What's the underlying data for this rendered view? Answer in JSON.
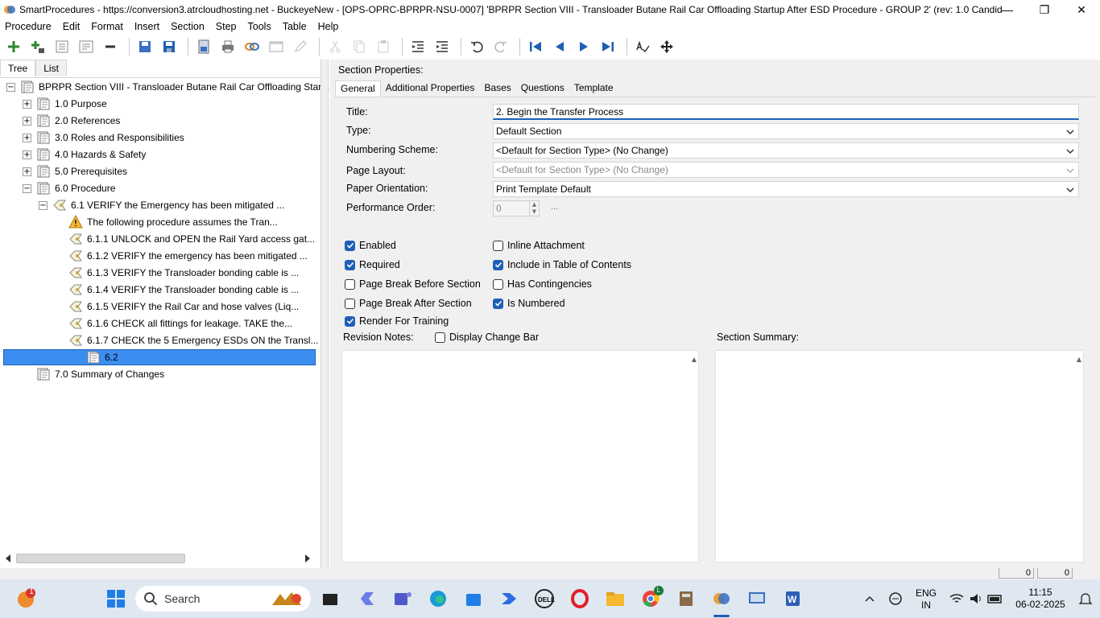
{
  "window": {
    "title": "SmartProcedures - https://conversion3.atrcloudhosting.net - BuckeyeNew - [OPS-OPRC-BPRPR-NSU-0007] 'BPRPR Section VIII - Transloader Butane Rail Car Offloading Startup After ESD Procedure - GROUP 2' (rev: 1.0 Candidat...",
    "controls": {
      "minimize": "—",
      "maximize": "❐",
      "close": "✕"
    }
  },
  "menu": [
    "Procedure",
    "Edit",
    "Format",
    "Insert",
    "Section",
    "Step",
    "Tools",
    "Table",
    "Help"
  ],
  "left_tabs": {
    "tree": "Tree",
    "list": "List"
  },
  "tree": [
    {
      "label": "BPRPR Section VIII - Transloader Butane Rail Car Offloading Start...",
      "level": 0,
      "expander": "−",
      "icon": "procedure-icon"
    },
    {
      "label": "1.0 Purpose",
      "level": 1,
      "expander": "+",
      "icon": "section-icon"
    },
    {
      "label": "2.0 References",
      "level": 1,
      "expander": "+",
      "icon": "section-icon"
    },
    {
      "label": "3.0 Roles and Responsibilities",
      "level": 1,
      "expander": "+",
      "icon": "section-icon"
    },
    {
      "label": "4.0 Hazards & Safety",
      "level": 1,
      "expander": "+",
      "icon": "section-icon"
    },
    {
      "label": "5.0 Prerequisites",
      "level": 1,
      "expander": "+",
      "icon": "section-icon"
    },
    {
      "label": "6.0 Procedure",
      "level": 1,
      "expander": "−",
      "icon": "section-icon"
    },
    {
      "label": "6.1 VERIFY the Emergency has been mitigated ...",
      "level": 2,
      "expander": "−",
      "icon": "step-icon"
    },
    {
      "label": "The following procedure assumes the Tran...",
      "level": 3,
      "expander": "",
      "icon": "warning-icon"
    },
    {
      "label": "6.1.1 UNLOCK and OPEN the Rail Yard access gat...",
      "level": 3,
      "expander": "",
      "icon": "step-icon"
    },
    {
      "label": "6.1.2 VERIFY the emergency has been mitigated ...",
      "level": 3,
      "expander": "",
      "icon": "step-icon"
    },
    {
      "label": "6.1.3 VERIFY the Transloader bonding cable is ...",
      "level": 3,
      "expander": "",
      "icon": "step-icon"
    },
    {
      "label": "6.1.4 VERIFY the Transloader bonding cable is ...",
      "level": 3,
      "expander": "",
      "icon": "step-icon"
    },
    {
      "label": "6.1.5 VERIFY the Rail Car and hose valves (Liq...",
      "level": 3,
      "expander": "",
      "icon": "step-icon"
    },
    {
      "label": "6.1.6 CHECK all fittings for leakage. TAKE the...",
      "level": 3,
      "expander": "",
      "icon": "step-icon"
    },
    {
      "label": "6.1.7 CHECK the 5 Emergency ESDs ON the Transl...",
      "level": 3,
      "expander": "",
      "icon": "step-icon"
    },
    {
      "label": "6.2",
      "level": 2,
      "expander": "",
      "icon": "section-icon",
      "selected": true
    },
    {
      "label": "7.0 Summary of Changes",
      "level": 1,
      "expander": "",
      "icon": "section-icon"
    }
  ],
  "section_properties": {
    "heading": "Section Properties:",
    "tabs": [
      "General",
      "Additional Properties",
      "Bases",
      "Questions",
      "Template"
    ],
    "fields": {
      "title_label": "Title:",
      "title_value": "2.        Begin the Transfer Process",
      "type_label": "Type:",
      "type_value": "Default Section",
      "numbering_label": "Numbering Scheme:",
      "numbering_value": "<Default for Section Type> (No Change)",
      "layout_label": "Page Layout:",
      "layout_value": "<Default for Section Type> (No Change)",
      "orientation_label": "Paper Orientation:",
      "orientation_value": "Print Template Default",
      "perf_label": "Performance Order:",
      "perf_value": "0",
      "perf_button": "..."
    },
    "checkboxes": {
      "enabled": {
        "label": "Enabled",
        "checked": true
      },
      "required": {
        "label": "Required",
        "checked": true
      },
      "page_break_before": {
        "label": "Page Break Before Section",
        "checked": false
      },
      "page_break_after": {
        "label": "Page Break After Section",
        "checked": false
      },
      "render_training": {
        "label": "Render For Training",
        "checked": true
      },
      "inline_attachment": {
        "label": "Inline Attachment",
        "checked": false
      },
      "include_toc": {
        "label": "Include in Table of Contents",
        "checked": true
      },
      "has_contingencies": {
        "label": "Has Contingencies",
        "checked": false
      },
      "is_numbered": {
        "label": "Is Numbered",
        "checked": true
      },
      "display_change_bar": {
        "label": "Display Change Bar",
        "checked": false
      }
    },
    "revision_notes_label": "Revision Notes:",
    "section_summary_label": "Section Summary:"
  },
  "status": {
    "field1": "0",
    "field2": "0"
  },
  "taskbar": {
    "search_label": "Search",
    "notification_count": "1",
    "lang": "ENG",
    "region": "IN",
    "time": "11:15",
    "date": "06-02-2025",
    "chrome_badge": "L"
  },
  "colors": {
    "accent": "#1f5fb5",
    "selection": "#3b8ef0",
    "panel": "#f0f0f0"
  }
}
